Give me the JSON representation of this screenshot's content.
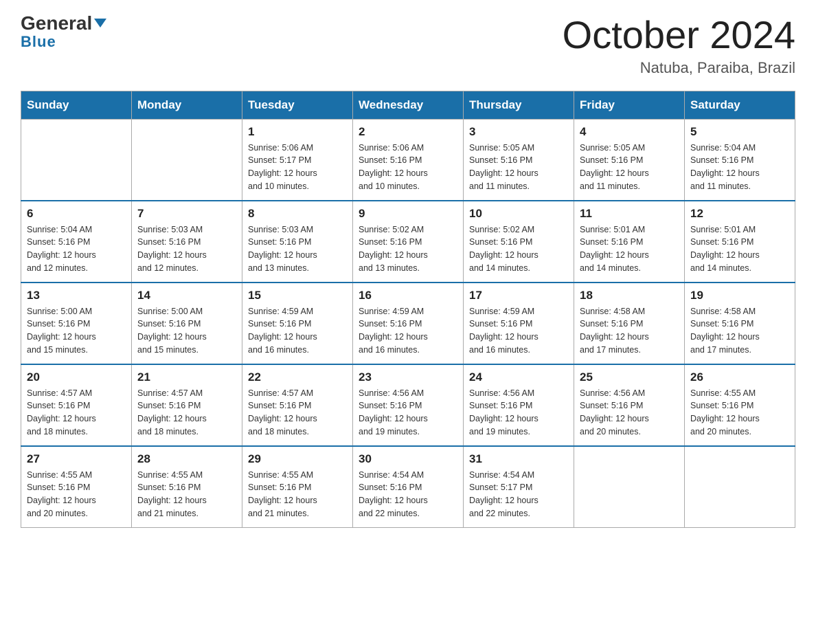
{
  "header": {
    "logo_line1": "General",
    "logo_line2": "Blue",
    "month_title": "October 2024",
    "location": "Natuba, Paraiba, Brazil"
  },
  "weekdays": [
    "Sunday",
    "Monday",
    "Tuesday",
    "Wednesday",
    "Thursday",
    "Friday",
    "Saturday"
  ],
  "weeks": [
    [
      {
        "day": "",
        "info": ""
      },
      {
        "day": "",
        "info": ""
      },
      {
        "day": "1",
        "info": "Sunrise: 5:06 AM\nSunset: 5:17 PM\nDaylight: 12 hours\nand 10 minutes."
      },
      {
        "day": "2",
        "info": "Sunrise: 5:06 AM\nSunset: 5:16 PM\nDaylight: 12 hours\nand 10 minutes."
      },
      {
        "day": "3",
        "info": "Sunrise: 5:05 AM\nSunset: 5:16 PM\nDaylight: 12 hours\nand 11 minutes."
      },
      {
        "day": "4",
        "info": "Sunrise: 5:05 AM\nSunset: 5:16 PM\nDaylight: 12 hours\nand 11 minutes."
      },
      {
        "day": "5",
        "info": "Sunrise: 5:04 AM\nSunset: 5:16 PM\nDaylight: 12 hours\nand 11 minutes."
      }
    ],
    [
      {
        "day": "6",
        "info": "Sunrise: 5:04 AM\nSunset: 5:16 PM\nDaylight: 12 hours\nand 12 minutes."
      },
      {
        "day": "7",
        "info": "Sunrise: 5:03 AM\nSunset: 5:16 PM\nDaylight: 12 hours\nand 12 minutes."
      },
      {
        "day": "8",
        "info": "Sunrise: 5:03 AM\nSunset: 5:16 PM\nDaylight: 12 hours\nand 13 minutes."
      },
      {
        "day": "9",
        "info": "Sunrise: 5:02 AM\nSunset: 5:16 PM\nDaylight: 12 hours\nand 13 minutes."
      },
      {
        "day": "10",
        "info": "Sunrise: 5:02 AM\nSunset: 5:16 PM\nDaylight: 12 hours\nand 14 minutes."
      },
      {
        "day": "11",
        "info": "Sunrise: 5:01 AM\nSunset: 5:16 PM\nDaylight: 12 hours\nand 14 minutes."
      },
      {
        "day": "12",
        "info": "Sunrise: 5:01 AM\nSunset: 5:16 PM\nDaylight: 12 hours\nand 14 minutes."
      }
    ],
    [
      {
        "day": "13",
        "info": "Sunrise: 5:00 AM\nSunset: 5:16 PM\nDaylight: 12 hours\nand 15 minutes."
      },
      {
        "day": "14",
        "info": "Sunrise: 5:00 AM\nSunset: 5:16 PM\nDaylight: 12 hours\nand 15 minutes."
      },
      {
        "day": "15",
        "info": "Sunrise: 4:59 AM\nSunset: 5:16 PM\nDaylight: 12 hours\nand 16 minutes."
      },
      {
        "day": "16",
        "info": "Sunrise: 4:59 AM\nSunset: 5:16 PM\nDaylight: 12 hours\nand 16 minutes."
      },
      {
        "day": "17",
        "info": "Sunrise: 4:59 AM\nSunset: 5:16 PM\nDaylight: 12 hours\nand 16 minutes."
      },
      {
        "day": "18",
        "info": "Sunrise: 4:58 AM\nSunset: 5:16 PM\nDaylight: 12 hours\nand 17 minutes."
      },
      {
        "day": "19",
        "info": "Sunrise: 4:58 AM\nSunset: 5:16 PM\nDaylight: 12 hours\nand 17 minutes."
      }
    ],
    [
      {
        "day": "20",
        "info": "Sunrise: 4:57 AM\nSunset: 5:16 PM\nDaylight: 12 hours\nand 18 minutes."
      },
      {
        "day": "21",
        "info": "Sunrise: 4:57 AM\nSunset: 5:16 PM\nDaylight: 12 hours\nand 18 minutes."
      },
      {
        "day": "22",
        "info": "Sunrise: 4:57 AM\nSunset: 5:16 PM\nDaylight: 12 hours\nand 18 minutes."
      },
      {
        "day": "23",
        "info": "Sunrise: 4:56 AM\nSunset: 5:16 PM\nDaylight: 12 hours\nand 19 minutes."
      },
      {
        "day": "24",
        "info": "Sunrise: 4:56 AM\nSunset: 5:16 PM\nDaylight: 12 hours\nand 19 minutes."
      },
      {
        "day": "25",
        "info": "Sunrise: 4:56 AM\nSunset: 5:16 PM\nDaylight: 12 hours\nand 20 minutes."
      },
      {
        "day": "26",
        "info": "Sunrise: 4:55 AM\nSunset: 5:16 PM\nDaylight: 12 hours\nand 20 minutes."
      }
    ],
    [
      {
        "day": "27",
        "info": "Sunrise: 4:55 AM\nSunset: 5:16 PM\nDaylight: 12 hours\nand 20 minutes."
      },
      {
        "day": "28",
        "info": "Sunrise: 4:55 AM\nSunset: 5:16 PM\nDaylight: 12 hours\nand 21 minutes."
      },
      {
        "day": "29",
        "info": "Sunrise: 4:55 AM\nSunset: 5:16 PM\nDaylight: 12 hours\nand 21 minutes."
      },
      {
        "day": "30",
        "info": "Sunrise: 4:54 AM\nSunset: 5:16 PM\nDaylight: 12 hours\nand 22 minutes."
      },
      {
        "day": "31",
        "info": "Sunrise: 4:54 AM\nSunset: 5:17 PM\nDaylight: 12 hours\nand 22 minutes."
      },
      {
        "day": "",
        "info": ""
      },
      {
        "day": "",
        "info": ""
      }
    ]
  ]
}
